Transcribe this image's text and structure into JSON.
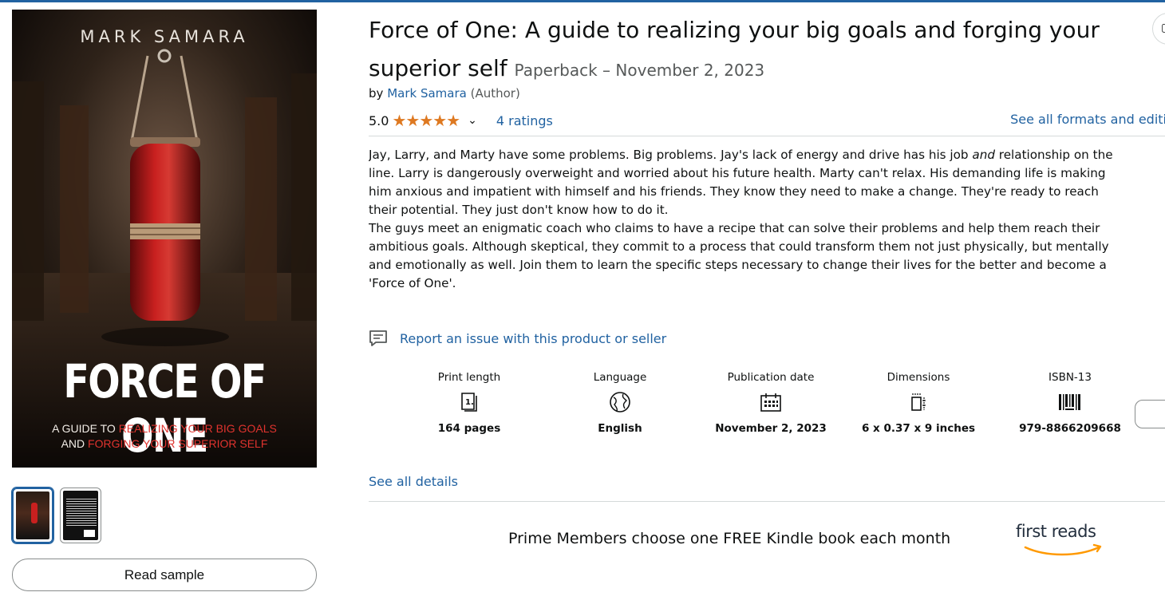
{
  "colors": {
    "link": "#2162a1",
    "star": "#de7921",
    "text": "#0f1111",
    "muted": "#565959",
    "cover_red": "#e0332e"
  },
  "cover": {
    "author": "MARK SAMARA",
    "title": "FORCE OF ONE",
    "subtitle_line1_plain": "A GUIDE TO ",
    "subtitle_line1_red": "REALIZING YOUR BIG GOALS",
    "subtitle_line2_plain": "AND ",
    "subtitle_line2_red": "FORGING YOUR SUPERIOR SELF"
  },
  "gallery": {
    "thumbnail_count": 2,
    "selected_index": 0,
    "read_sample_label": "Read sample"
  },
  "product": {
    "title_line1": "Force of One: A guide to realizing your big goals and forging your",
    "title_line2": "superior self",
    "format": "Paperback – November 2, 2023",
    "by_prefix": "by",
    "author": "Mark Samara",
    "author_role": "(Author)",
    "rating_value": "5.0",
    "stars": "★★★★★",
    "star_count": 5,
    "ratings_link": "4 ratings",
    "formats_link": "See all formats and editi"
  },
  "description": {
    "line1_pre": "Jay, Larry, and Marty have some problems. Big problems. Jay's lack of energy and drive has his job ",
    "line1_em": "and",
    "line1_post": " relationship on the",
    "line2": "line. Larry is dangerously overweight and worried about his future health. Marty can't relax. His demanding life is making",
    "line3": "him anxious and impatient with himself and his friends. They know they need to make a change. They're ready to reach",
    "line4": "their potential. They just don't know how to do it.",
    "line5": "The guys meet an enigmatic coach who claims to have a recipe that can solve their problems and help them reach their",
    "line6": "ambitious goals. Although skeptical, they commit to a process that could transform them not just physically, but mentally",
    "line7": "and emotionally as well. Join them to learn the specific steps necessary to change their lives for the better and become a",
    "line8": "'Force of One'."
  },
  "report_link": "Report an issue with this product or seller",
  "details": [
    {
      "label": "Print length",
      "value": "164 pages",
      "icon": "book-pages-icon"
    },
    {
      "label": "Language",
      "value": "English",
      "icon": "globe-icon"
    },
    {
      "label": "Publication date",
      "value": "November 2, 2023",
      "icon": "calendar-icon"
    },
    {
      "label": "Dimensions",
      "value": "6 x 0.37 x 9 inches",
      "icon": "dimensions-icon"
    },
    {
      "label": "ISBN-13",
      "value": "979-8866209668",
      "icon": "barcode-icon"
    }
  ],
  "see_all_details": "See all details",
  "promo": {
    "text": "Prime Members choose one FREE Kindle book each month",
    "logo_text": "first reads"
  }
}
